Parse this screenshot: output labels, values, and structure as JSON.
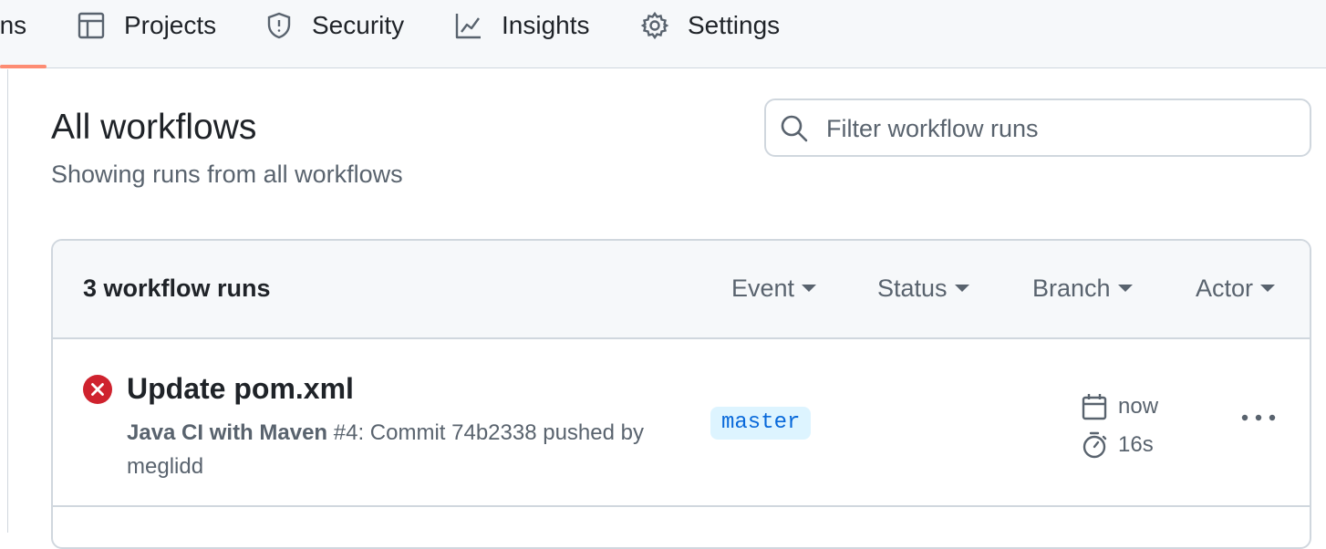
{
  "nav": {
    "tabs": [
      {
        "label": "ons",
        "icon": "play-icon",
        "selected": true
      },
      {
        "label": "Projects",
        "icon": "table-icon"
      },
      {
        "label": "Security",
        "icon": "shield-icon"
      },
      {
        "label": "Insights",
        "icon": "graph-icon"
      },
      {
        "label": "Settings",
        "icon": "gear-icon"
      }
    ]
  },
  "page": {
    "title": "All workflows",
    "subtitle": "Showing runs from all workflows"
  },
  "search": {
    "placeholder": "Filter workflow runs",
    "value": ""
  },
  "runs_box": {
    "count_label": "3 workflow runs",
    "filters": {
      "event": "Event",
      "status": "Status",
      "branch": "Branch",
      "actor": "Actor"
    },
    "runs": [
      {
        "status": "failure",
        "title": "Update pom.xml",
        "workflow": "Java CI with Maven",
        "run_number": "#4",
        "description": ": Commit 74b2338 pushed by",
        "actor": "meglidd",
        "branch": "master",
        "when": "now",
        "duration": "16s"
      }
    ]
  },
  "colors": {
    "failure": "#cf222e",
    "underline": "#fd8c73",
    "branch_bg": "#ddf4ff",
    "branch_fg": "#0969da"
  }
}
